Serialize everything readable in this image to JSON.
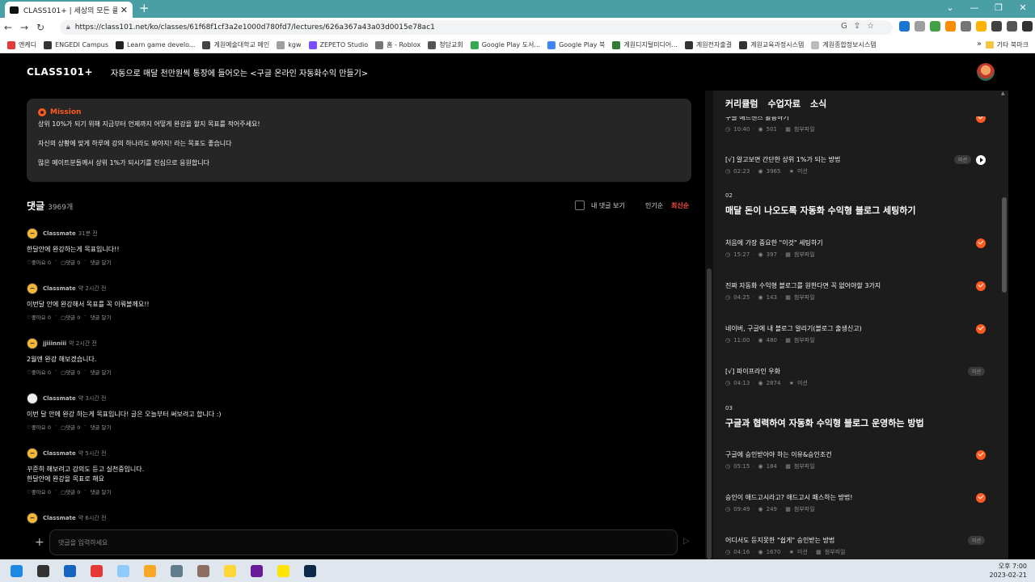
{
  "browser": {
    "tab_title": "CLASS101+ | 세상의 모든 클래스",
    "url": "https://class101.net/ko/classes/61f68f1cf3a2e1000d780fd7/lectures/626a367a43a03d0015e78ac1",
    "bookmarks": [
      {
        "label": "엔케디",
        "color": "#e53935"
      },
      {
        "label": "ENGEDI Campus",
        "color": "#333333"
      },
      {
        "label": "Learn game develo...",
        "color": "#222222"
      },
      {
        "label": "계원예술대학교 메인",
        "color": "#444444"
      },
      {
        "label": "kgw",
        "color": "#9e9e9e"
      },
      {
        "label": "ZEPETO Studio",
        "color": "#7c4dff"
      },
      {
        "label": "홈 - Roblox",
        "color": "#777777"
      },
      {
        "label": "청담교회",
        "color": "#555555"
      },
      {
        "label": "Google Play 도서...",
        "color": "#34a853"
      },
      {
        "label": "Google Play 북",
        "color": "#4285f4"
      },
      {
        "label": "계원디지털미디어...",
        "color": "#2e7d32"
      },
      {
        "label": "계원전자출결",
        "color": "#333333"
      },
      {
        "label": "계원교육과정시스템",
        "color": "#333333"
      },
      {
        "label": "계원종합정보시스템",
        "color": "#bbbbbb"
      }
    ],
    "bookmarks_more": "»",
    "other_bookmarks": "기타 북마크"
  },
  "header": {
    "logo": "CLASS101+",
    "class_title": "자동으로 매달 천만원씩 통장에 들어오는 <구글 온라인 자동화수익 만들기>"
  },
  "mission": {
    "label": "Mission",
    "lines": [
      "상위 10%가 되기 위해 지금부터 언제까지 어떻게 완강을 할지 목표를 적어주세요!",
      "자신의 상황에 맞게 하루에 강의 하나라도 봐야지! 라는 목표도 좋습니다",
      "많은 메이트분들께서 상위 1%가 되시기를 진심으로 응원합니다"
    ]
  },
  "comments": {
    "title": "댓글",
    "count": "3969개",
    "my_comments": "내 댓글 보기",
    "sort_popular": "인기순",
    "sort_latest": "최신순",
    "items": [
      {
        "author": "Classmate",
        "time": "31분 전",
        "body": "한달안에 완강하는게 목표입니다!!",
        "likes": "♡좋아요 0",
        "replies": "▢댓글 0",
        "reply": "댓글 달기"
      },
      {
        "author": "Classmate",
        "time": "약 2시간 전",
        "body": "이번달 안에 완강해서 목표를 꼭 이뤄볼께요!!",
        "likes": "♡좋아요 0",
        "replies": "▢댓글 0",
        "reply": "댓글 달기"
      },
      {
        "author": "jjiiinniii",
        "time": "약 2시간 전",
        "body": "2월엔 완강 해보겠습니다.",
        "likes": "♡좋아요 0",
        "replies": "▢댓글 0",
        "reply": "댓글 달기"
      },
      {
        "author": "Classmate",
        "time": "약 3시간 전",
        "body": "이번 달 안에 완강 하는게 목표입니다! 글은 오늘부터 써보려고 합니다 :)",
        "likes": "♡좋아요 0",
        "replies": "▢댓글 0",
        "reply": "댓글 달기"
      },
      {
        "author": "Classmate",
        "time": "약 5시간 전",
        "body": "꾸준히 해보려고 강의도 듣고 실천중입니다.",
        "body2": "한달안에 완강을 목표로 해요",
        "likes": "♡좋아요 0",
        "replies": "▢댓글 0",
        "reply": "댓글 달기"
      },
      {
        "author": "Classmate",
        "time": "약 6시간 전"
      }
    ],
    "input_placeholder": "댓글을 입력하세요"
  },
  "sidebar": {
    "tabs": [
      "커리큘럼",
      "수업자료",
      "소식"
    ],
    "lessons_top": [
      {
        "title": "구글 애드센스 활용하기",
        "duration": "10:40",
        "views": "501",
        "extra": "첨부파일",
        "status": "done"
      },
      {
        "title": "[√] 알고보면 간단한 상위 1%가 되는 방법",
        "duration": "02:23",
        "views": "3965",
        "extra": "미션",
        "status": "playing",
        "chip": "미션"
      }
    ],
    "chapters": [
      {
        "num": "02",
        "title": "매달 돈이 나오도록 자동화 수익형 블로그 세팅하기",
        "lessons": [
          {
            "title": "처음에 가장 중요한 \"이것\" 세팅하기",
            "duration": "15:27",
            "views": "397",
            "extra": "첨부파일",
            "status": "done"
          },
          {
            "title": "진짜 자동화 수익형 블로그를 원한다면 꼭 없어야할 3가지",
            "duration": "04:25",
            "views": "143",
            "extra": "첨부파일",
            "status": "done"
          },
          {
            "title": "네이버, 구글에 내 블로그 알리기(블로그 출생신고)",
            "duration": "11:00",
            "views": "480",
            "extra": "첨부파일",
            "status": "done"
          },
          {
            "title": "[√] 파이프라인 우화",
            "duration": "04:13",
            "views": "2874",
            "extra": "미션",
            "status": "chip",
            "chip": "미션"
          }
        ]
      },
      {
        "num": "03",
        "title": "구글과 협력하여 자동화 수익형 블로그 운영하는 방법",
        "lessons": [
          {
            "title": "구글에 승인받아야 하는 이유&승인조건",
            "duration": "05:15",
            "views": "184",
            "extra": "첨부파일",
            "status": "done"
          },
          {
            "title": "승인이 애드고시라고? 애드고시 패스하는 방법!",
            "duration": "09:49",
            "views": "249",
            "extra": "첨부파일",
            "status": "done"
          },
          {
            "title": "어디서도 듣지못한 \"쉽게\" 승인받는 방법",
            "duration": "04:16",
            "views": "1670",
            "extra": "미션",
            "extra2": "첨부파일",
            "status": "chip",
            "chip": "미션"
          }
        ]
      }
    ]
  },
  "taskbar": {
    "time": "오후 7:00",
    "date": "2023-02-21",
    "icons": [
      {
        "name": "start",
        "color": "#1e88e5"
      },
      {
        "name": "search",
        "color": "#333333"
      },
      {
        "name": "app-blue",
        "color": "#1565c0"
      },
      {
        "name": "chrome",
        "color": "#e53935"
      },
      {
        "name": "app-light",
        "color": "#90caf9"
      },
      {
        "name": "explorer",
        "color": "#f9a825"
      },
      {
        "name": "calculator",
        "color": "#607d8b"
      },
      {
        "name": "app-feather",
        "color": "#8d6e63"
      },
      {
        "name": "app-yellow",
        "color": "#fdd835"
      },
      {
        "name": "app-purple",
        "color": "#6a1b9a"
      },
      {
        "name": "kakaotalk",
        "color": "#fee500"
      },
      {
        "name": "photoshop",
        "color": "#0b2a4a"
      }
    ]
  }
}
